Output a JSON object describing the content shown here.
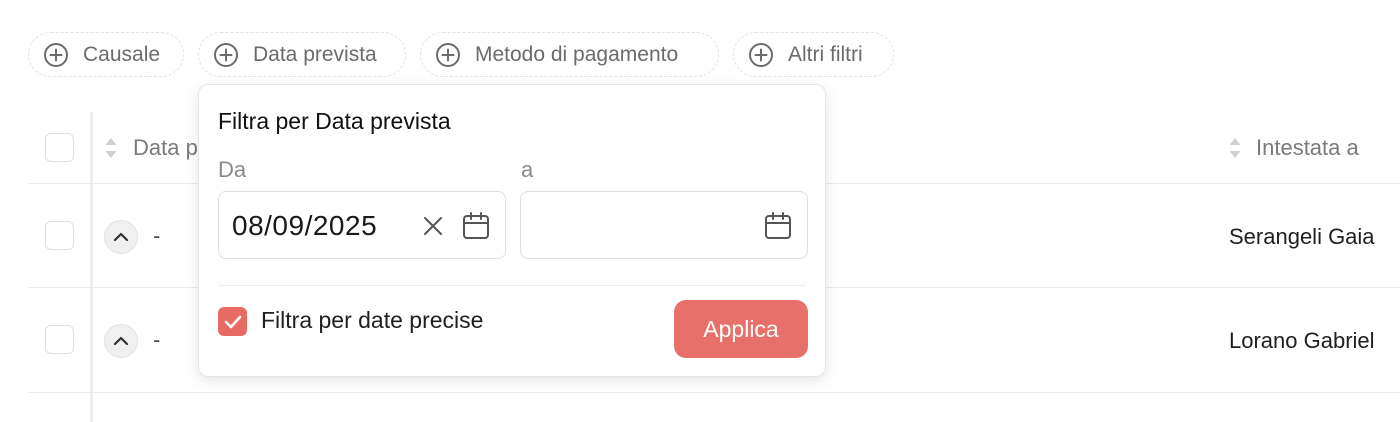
{
  "filters": [
    {
      "label": "Causale",
      "icon": "plus-circle-icon"
    },
    {
      "label": "Data prevista",
      "icon": "plus-circle-icon"
    },
    {
      "label": "Metodo di pagamento",
      "icon": "plus-circle-icon"
    },
    {
      "label": "Altri filtri",
      "icon": "plus-circle-icon"
    }
  ],
  "table": {
    "columns": [
      "Data p",
      "Intestata a"
    ],
    "rows": [
      {
        "date": "-",
        "intestata": "Serangeli Gaia"
      },
      {
        "date": "-",
        "intestata": "Lorano Gabriel"
      }
    ]
  },
  "popover": {
    "title": "Filtra per Data prevista",
    "from_label": "Da",
    "to_label": "a",
    "from_value": "08/09/2025",
    "to_value": "",
    "precise_label": "Filtra per date precise",
    "precise_checked": true,
    "apply_label": "Applica",
    "accent_color": "#e8706a"
  }
}
